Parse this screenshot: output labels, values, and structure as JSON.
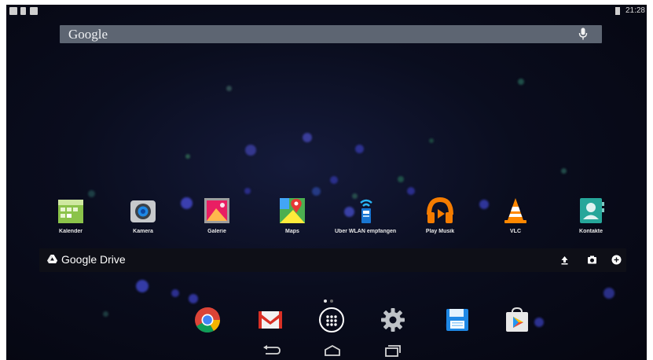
{
  "status_bar": {
    "time": "21:28",
    "left_icons": [
      "image-notification-icon",
      "download-notification-icon",
      "screenshot-notification-icon"
    ],
    "right_icons": [
      "battery-icon"
    ]
  },
  "search": {
    "logo_text": "Google",
    "mic_icon": "mic-icon"
  },
  "apps": [
    {
      "label": "Kalender",
      "icon": "calendar-icon"
    },
    {
      "label": "Kamera",
      "icon": "camera-icon"
    },
    {
      "label": "Galerie",
      "icon": "gallery-icon"
    },
    {
      "label": "Maps",
      "icon": "maps-icon"
    },
    {
      "label": "Über WLAN empfangen (Tota",
      "icon": "wifi-receive-icon"
    },
    {
      "label": "Play Musik",
      "icon": "headphones-icon"
    },
    {
      "label": "VLC",
      "icon": "vlc-cone-icon"
    },
    {
      "label": "Kontakte",
      "icon": "contacts-icon"
    }
  ],
  "drive_widget": {
    "title": "Google Drive",
    "logo_icon": "google-drive-icon",
    "actions": [
      "upload-icon",
      "camera-icon",
      "add-icon"
    ]
  },
  "page_indicator": {
    "pages": 2,
    "current": 1
  },
  "dock": [
    {
      "icon": "chrome-icon"
    },
    {
      "icon": "gmail-icon"
    },
    {
      "icon": "app-drawer-icon"
    },
    {
      "icon": "settings-gear-icon"
    },
    {
      "icon": "save-app-icon"
    },
    {
      "icon": "play-store-icon"
    }
  ],
  "nav_bar": [
    "back-icon",
    "home-icon",
    "recents-icon"
  ],
  "colors": {
    "background": "#050610",
    "search_bar": "#5d6572",
    "chrome_red": "#db4437",
    "chrome_yellow": "#f4b400",
    "chrome_green": "#0f9d58",
    "chrome_blue": "#4285f4",
    "music_orange": "#f57c00",
    "vlc_orange": "#ff8800",
    "gmail_red": "#d93025"
  }
}
